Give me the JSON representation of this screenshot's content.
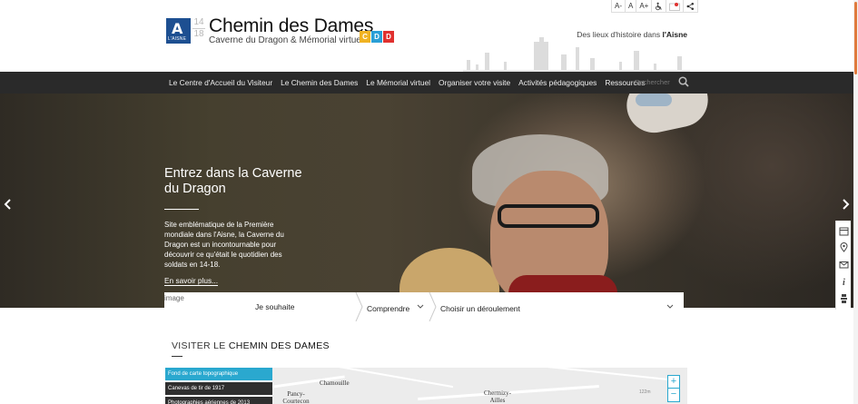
{
  "header": {
    "logo_text": "L'AISNE",
    "years": [
      "14",
      "18"
    ],
    "title_main": "Chemin",
    "title_rest": " des Dames",
    "subtitle": "Caverne du Dragon & Mémorial virtuel",
    "tagline_prefix": "Des lieux d'histoire dans ",
    "tagline_bold": "l'Aisne",
    "tiles": [
      {
        "label": "C",
        "color": "#f0b323"
      },
      {
        "label": "D",
        "color": "#2a9fd6"
      },
      {
        "label": "D",
        "color": "#e0312f"
      }
    ],
    "accessibility": {
      "font_small": "A-",
      "font_normal": "A",
      "font_large": "A+"
    }
  },
  "nav": {
    "items": [
      "Le Centre d'Accueil du Visiteur",
      "Le Chemin des Dames",
      "Le Mémorial virtuel",
      "Organiser votre visite",
      "Activités pédagogiques",
      "Ressources"
    ],
    "search_placeholder": "Rechercher"
  },
  "hero": {
    "title": "Entrez dans la Caverne du Dragon",
    "text": "Site emblématique de la Première mondiale dans l'Aisne, la Caverne du Dragon est un incontournable pour découvrir ce qu'était le quotidien des soldats en 14-18.",
    "link": "En savoir plus..."
  },
  "finder": {
    "image_alt": "image",
    "field1": "Je souhaite",
    "field2": "Comprendre",
    "field3": "Choisir un déroulement"
  },
  "section": {
    "title_prefix": "VISITER LE ",
    "title_bold": "CHEMIN DES DAMES"
  },
  "map": {
    "layers": [
      {
        "label": "Fond de carte topographique",
        "color": "#2aa8cf"
      },
      {
        "label": "Canevas de tir de 1917",
        "color": "#2f2f2f"
      },
      {
        "label": "Photographies aériennes de 2013",
        "color": "#2f2f2f"
      }
    ],
    "places": [
      "Chamouille",
      "Pancy-\nCourtecon",
      "Chermizy-\nAilles"
    ],
    "altitude": "122m",
    "zoom_in": "+",
    "zoom_out": "−"
  },
  "colors": {
    "accent": "#2aa8cf",
    "nav_bg": "#2a2a2a"
  }
}
